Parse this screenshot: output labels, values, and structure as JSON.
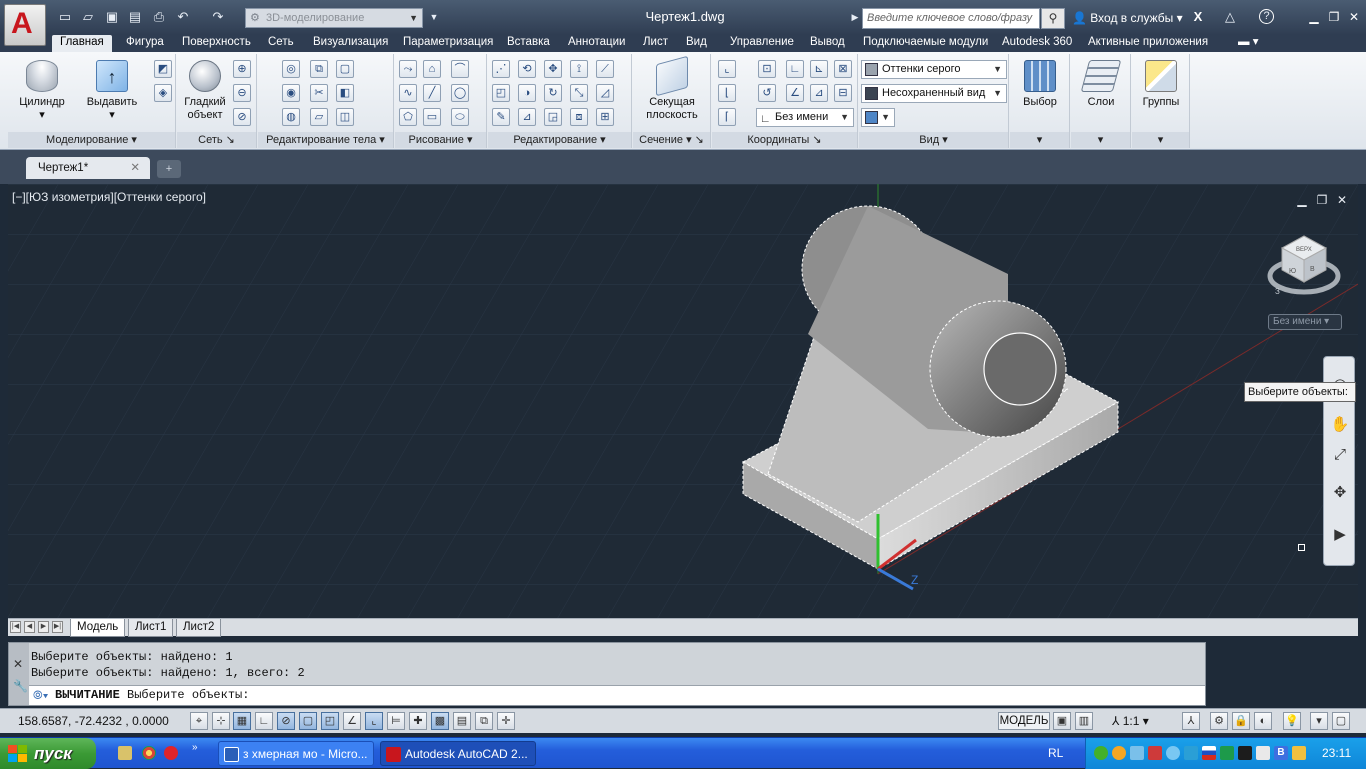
{
  "titlebar": {
    "workspace": "3D-моделирование",
    "document_title": "Чертеж1.dwg",
    "search_placeholder": "Введите ключевое слово/фразу",
    "signin_label": "Вход в службы"
  },
  "ribbon_tabs": [
    "Главная",
    "Фигура",
    "Поверхность",
    "Сеть",
    "Визуализация",
    "Параметризация",
    "Вставка",
    "Аннотации",
    "Лист",
    "Вид",
    "Управление",
    "Вывод",
    "Подключаемые модули",
    "Autodesk 360",
    "Активные приложения"
  ],
  "ribbon": {
    "panels": {
      "modeling": "Моделирование",
      "mesh": "Сеть",
      "solid_edit": "Редактирование тела",
      "draw": "Рисование",
      "modify": "Редактирование",
      "section": "Сечение",
      "coordinates": "Координаты",
      "view": "Вид"
    },
    "buttons": {
      "cylinder": "Цилиндр",
      "extrude": "Выдавить",
      "smooth_object_1": "Гладкий",
      "smooth_object_2": "объект",
      "section_plane_1": "Секущая",
      "section_plane_2": "плоскость",
      "selection": "Выбор",
      "layers": "Слои",
      "groups": "Группы"
    },
    "view_combos": {
      "visual_style": "Оттенки серого",
      "named_view": "Несохраненный вид",
      "ucs_name": "Без имени"
    }
  },
  "doc_tab": "Чертеж1*",
  "viewport": {
    "label": "[−][ЮЗ изометрия][Оттенки серого]",
    "viewcube_ucs": "Без имени",
    "viewcube_faces": [
      "ВЕРХ",
      "Ю",
      "В",
      "З"
    ],
    "tooltip": "Выберите объекты:"
  },
  "layout_tabs": [
    "Модель",
    "Лист1",
    "Лист2"
  ],
  "command": {
    "history": [
      "Выберите объекты: найдено: 1",
      "Выберите объекты: найдено: 1, всего: 2"
    ],
    "keyword": "ВЫЧИТАНИЕ",
    "prompt": "Выберите объекты:"
  },
  "status": {
    "coordinates": "158.6587, -72.4232 , 0.0000",
    "model": "МОДЕЛЬ",
    "scale": "1:1"
  },
  "taskbar": {
    "start": "пуск",
    "tasks": [
      "з хмерная мо - Micro...",
      "Autodesk AutoCAD 2..."
    ],
    "language": "RL",
    "clock": "23:11"
  }
}
